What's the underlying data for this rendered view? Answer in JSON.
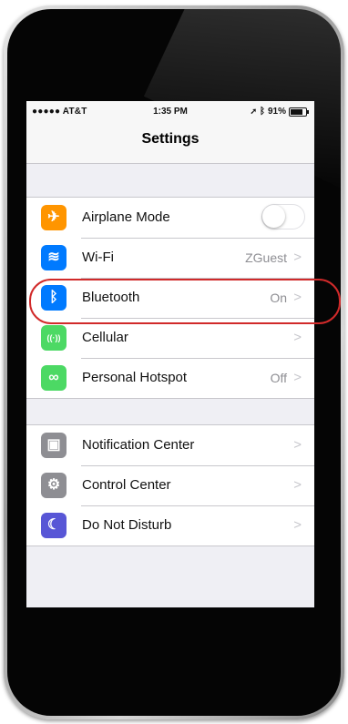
{
  "status_bar": {
    "carrier": "●●●●● AT&T",
    "time": "1:35 PM",
    "battery_text": "91%",
    "battery_level": 0.91
  },
  "nav": {
    "title": "Settings"
  },
  "groups": [
    {
      "rows": [
        {
          "label": "Airplane Mode",
          "icon": "airplane-icon",
          "icon_glyph": "✈",
          "color": "#ff9500",
          "toggle": false
        },
        {
          "label": "Wi-Fi",
          "icon": "wifi-icon",
          "icon_glyph": "≋",
          "color": "#007aff",
          "value": "ZGuest"
        },
        {
          "label": "Bluetooth",
          "icon": "bluetooth-icon",
          "icon_glyph": "ᛒ",
          "color": "#007aff",
          "value": "On"
        },
        {
          "label": "Cellular",
          "icon": "cellular-icon",
          "icon_glyph": "((·))",
          "color": "#4cd964",
          "value": ""
        },
        {
          "label": "Personal Hotspot",
          "icon": "hotspot-icon",
          "icon_glyph": "∞",
          "color": "#4cd964",
          "value": "Off"
        }
      ]
    },
    {
      "rows": [
        {
          "label": "Notification Center",
          "icon": "notification-center-icon",
          "icon_glyph": "▣",
          "color": "#8e8e93",
          "value": ""
        },
        {
          "label": "Control Center",
          "icon": "control-center-icon",
          "icon_glyph": "⚙",
          "color": "#8e8e93",
          "value": ""
        },
        {
          "label": "Do Not Disturb",
          "icon": "moon-icon",
          "icon_glyph": "☾",
          "color": "#5856d6",
          "value": ""
        }
      ]
    }
  ],
  "colors": {
    "highlight": "#d12a2a",
    "chevron": "#c7c7cc"
  },
  "chevron_glyph": ">"
}
